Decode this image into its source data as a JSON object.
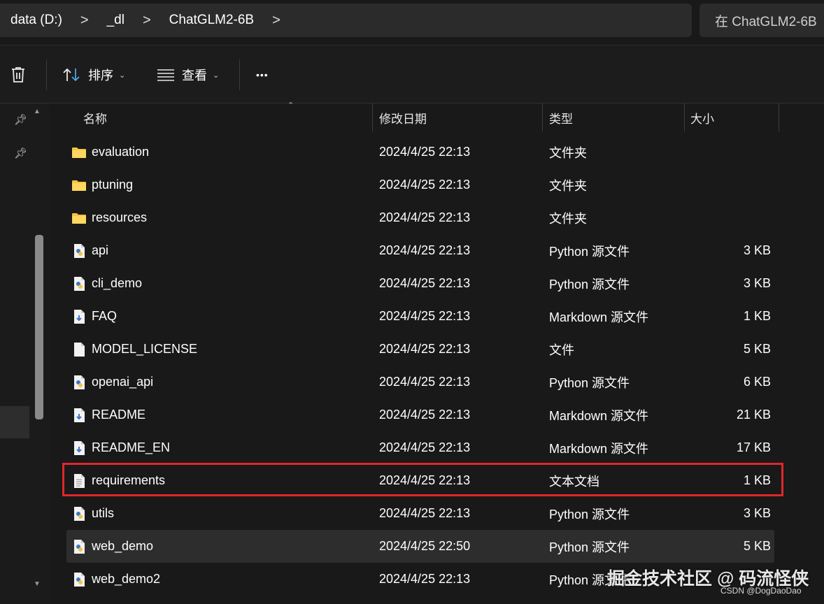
{
  "breadcrumb": {
    "items": [
      "data (D:)",
      "_dl",
      "ChatGLM2-6B"
    ],
    "separator": ">"
  },
  "search": {
    "placeholder": "在 ChatGLM2-6B"
  },
  "toolbar": {
    "sort_label": "排序",
    "view_label": "查看",
    "more_label": "•••"
  },
  "columns": {
    "name": "名称",
    "date": "修改日期",
    "type": "类型",
    "size": "大小"
  },
  "files": [
    {
      "name": "evaluation",
      "date": "2024/4/25 22:13",
      "type": "文件夹",
      "size": "",
      "icon": "folder-icon"
    },
    {
      "name": "ptuning",
      "date": "2024/4/25 22:13",
      "type": "文件夹",
      "size": "",
      "icon": "folder-icon"
    },
    {
      "name": "resources",
      "date": "2024/4/25 22:13",
      "type": "文件夹",
      "size": "",
      "icon": "folder-icon"
    },
    {
      "name": "api",
      "date": "2024/4/25 22:13",
      "type": "Python 源文件",
      "size": "3 KB",
      "icon": "python-file-icon"
    },
    {
      "name": "cli_demo",
      "date": "2024/4/25 22:13",
      "type": "Python 源文件",
      "size": "3 KB",
      "icon": "python-file-icon"
    },
    {
      "name": "FAQ",
      "date": "2024/4/25 22:13",
      "type": "Markdown 源文件",
      "size": "1 KB",
      "icon": "markdown-file-icon"
    },
    {
      "name": "MODEL_LICENSE",
      "date": "2024/4/25 22:13",
      "type": "文件",
      "size": "5 KB",
      "icon": "file-icon"
    },
    {
      "name": "openai_api",
      "date": "2024/4/25 22:13",
      "type": "Python 源文件",
      "size": "6 KB",
      "icon": "python-file-icon"
    },
    {
      "name": "README",
      "date": "2024/4/25 22:13",
      "type": "Markdown 源文件",
      "size": "21 KB",
      "icon": "markdown-file-icon"
    },
    {
      "name": "README_EN",
      "date": "2024/4/25 22:13",
      "type": "Markdown 源文件",
      "size": "17 KB",
      "icon": "markdown-file-icon"
    },
    {
      "name": "requirements",
      "date": "2024/4/25 22:13",
      "type": "文本文档",
      "size": "1 KB",
      "icon": "text-file-icon"
    },
    {
      "name": "utils",
      "date": "2024/4/25 22:13",
      "type": "Python 源文件",
      "size": "3 KB",
      "icon": "python-file-icon"
    },
    {
      "name": "web_demo",
      "date": "2024/4/25 22:50",
      "type": "Python 源文件",
      "size": "5 KB",
      "icon": "python-file-icon"
    },
    {
      "name": "web_demo2",
      "date": "2024/4/25 22:13",
      "type": "Python 源文件",
      "size": "",
      "icon": "python-file-icon"
    }
  ],
  "watermark": {
    "main": "掘金技术社区 @ 码流怪侠",
    "sub": "CSDN @DogDaoDao"
  },
  "colors": {
    "highlight_box": "#e0262b",
    "folder": "#f5c342",
    "python_blue": "#3a77c4"
  }
}
